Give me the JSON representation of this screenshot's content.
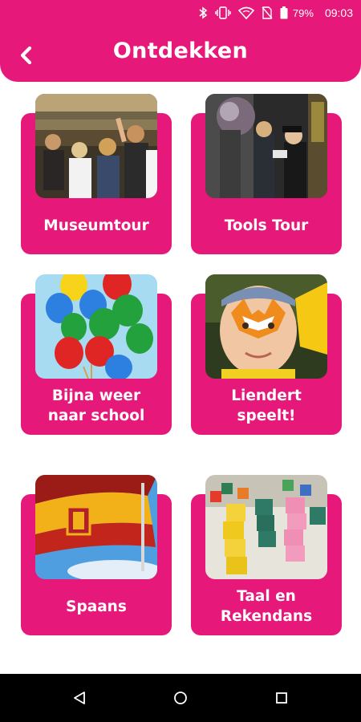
{
  "status_bar": {
    "battery": "79%",
    "time": "09:03",
    "icons": [
      "bluetooth-icon",
      "vibrate-icon",
      "wifi-icon",
      "no-sim-icon",
      "battery-icon"
    ]
  },
  "header": {
    "title": "Ontdekken",
    "back_icon": "chevron-left-icon"
  },
  "cards": [
    {
      "name": "Museumtour",
      "title_lines": [
        "Museumtour"
      ],
      "image": "museum-photo"
    },
    {
      "name": "Tools Tour",
      "title_lines": [
        "Tools Tour"
      ],
      "image": "tools-photo"
    },
    {
      "name": "Bijna weer naar school",
      "title_lines": [
        "Bijna weer",
        "naar school"
      ],
      "image": "balloons-photo"
    },
    {
      "name": "Liendert speelt!",
      "title_lines": [
        "Liendert",
        "speelt!"
      ],
      "image": "facepaint-boy-photo"
    },
    {
      "name": "Spaans",
      "title_lines": [
        "Spaans"
      ],
      "image": "spanish-flag-photo"
    },
    {
      "name": "Taal en Rekendans",
      "title_lines": [
        "Taal en",
        "Rekendans"
      ],
      "image": "blocks-photo"
    }
  ],
  "nav_bar": {
    "buttons": [
      "back-triangle-icon",
      "home-circle-icon",
      "recents-square-icon"
    ]
  },
  "colors": {
    "brand": "#e6197a",
    "nav_bar": "#000000",
    "text_on_brand": "#ffffff"
  }
}
